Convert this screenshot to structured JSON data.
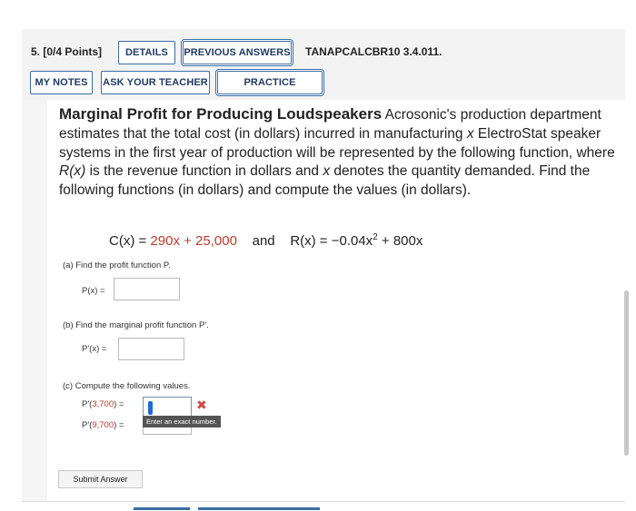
{
  "header": {
    "question_number": "5.  [0/4 Points]",
    "details_label": "DETAILS",
    "previous_answers_label": "PREVIOUS ANSWERS",
    "question_code": "TANAPCALCBR10 3.4.011.",
    "my_notes_label": "MY NOTES",
    "ask_teacher_label": "ASK YOUR TEACHER",
    "practice_another_label": "PRACTICE ANOTHER"
  },
  "problem": {
    "title": "Marginal Profit for Producing Loudspeakers",
    "text_1": " Acrosonic's production department estimates that the total cost (in dollars) incurred in manufacturing ",
    "var_x1": "x",
    "text_2": " ElectroStat speaker systems in the first year of production will be represented by the following function, where ",
    "var_rx": "R(x)",
    "text_3": " is the revenue function in dollars and ",
    "var_x2": "x",
    "text_4": " denotes the quantity demanded. Find the following functions (in dollars) and compute the values (in dollars)."
  },
  "formula": {
    "cost_lhs": "C(x) = ",
    "cost_rhs": "290x + 25,000",
    "and": "and",
    "rev_lhs": "R(x) = −0.04x",
    "rev_exp": "2",
    "rev_tail": " + 800x"
  },
  "part_a": {
    "prompt": "(a)   Find the profit function P.",
    "label": "P(x) =",
    "value": ""
  },
  "part_b": {
    "prompt": "(b)   Find the marginal profit function P'.",
    "label": "P'(x) =",
    "value": ""
  },
  "part_c": {
    "prompt": "(c)   Compute the following values.",
    "label1_pre": "P'(",
    "label1_val": "3,700",
    "label1_post": ") =",
    "label2_pre": "P'(",
    "label2_val": "9,700",
    "label2_post": ") =",
    "tooltip": "Enter an exact number.",
    "value1": "",
    "value2": ""
  },
  "submit_label": "Submit Answer",
  "colors": {
    "accent": "#3a6ea5",
    "error": "#c0392b",
    "cursor": "#1e6ad6"
  }
}
